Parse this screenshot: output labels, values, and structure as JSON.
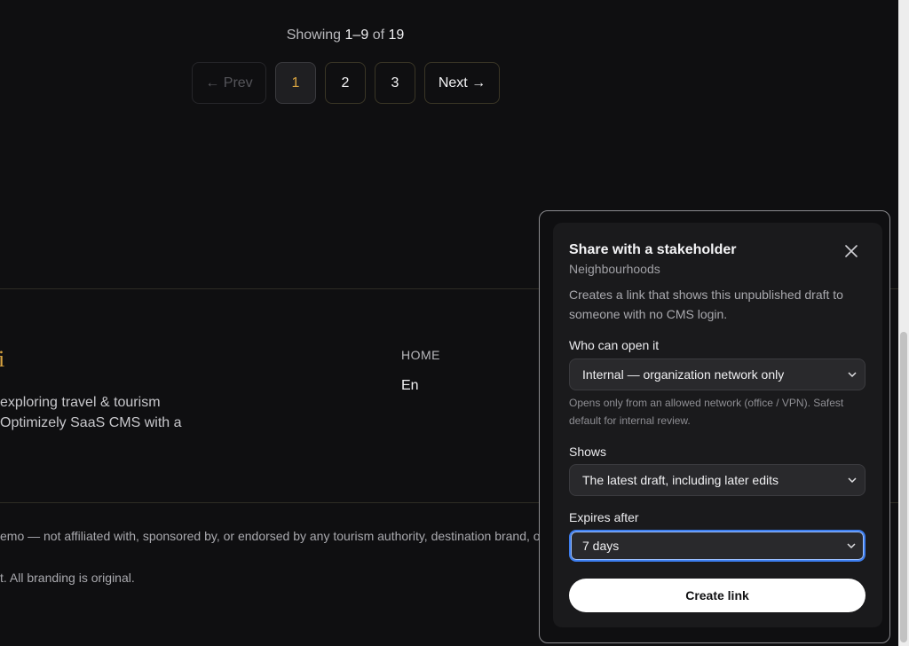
{
  "pagination": {
    "showing_prefix": "Showing",
    "range": "1–9",
    "of": "of",
    "total": "19",
    "prev_label": "← Prev",
    "pages": [
      "1",
      "2",
      "3"
    ],
    "active_page": "1",
    "next_label": "Next →"
  },
  "footer": {
    "brand_fragment": "i",
    "about_line1": "exploring travel & tourism",
    "about_line2": "Optimizely SaaS CMS with a",
    "nav_home": "HOME",
    "language": "En",
    "disclaimer": "emo — not affiliated with, sponsored by, or endorsed by any tourism authority, destination brand, or p",
    "branding_note": "t. All branding is original."
  },
  "share_dialog": {
    "title": "Share with a stakeholder",
    "subtitle": "Neighbourhoods",
    "close_icon": "close-icon",
    "description": "Creates a link that shows this unpublished draft to someone with no CMS login.",
    "access": {
      "label": "Who can open it",
      "value": "Internal — organization network only",
      "hint": "Opens only from an allowed network (office / VPN). Safest default for internal review."
    },
    "shows": {
      "label": "Shows",
      "value": "The latest draft, including later edits"
    },
    "expires": {
      "label": "Expires after",
      "value": "7 days"
    },
    "create_label": "Create link"
  },
  "colors": {
    "accent_gold": "#d9a441",
    "focus_blue": "#3d7ef0",
    "background": "#0f0f11",
    "dialog_bg": "#1a1a1c"
  }
}
